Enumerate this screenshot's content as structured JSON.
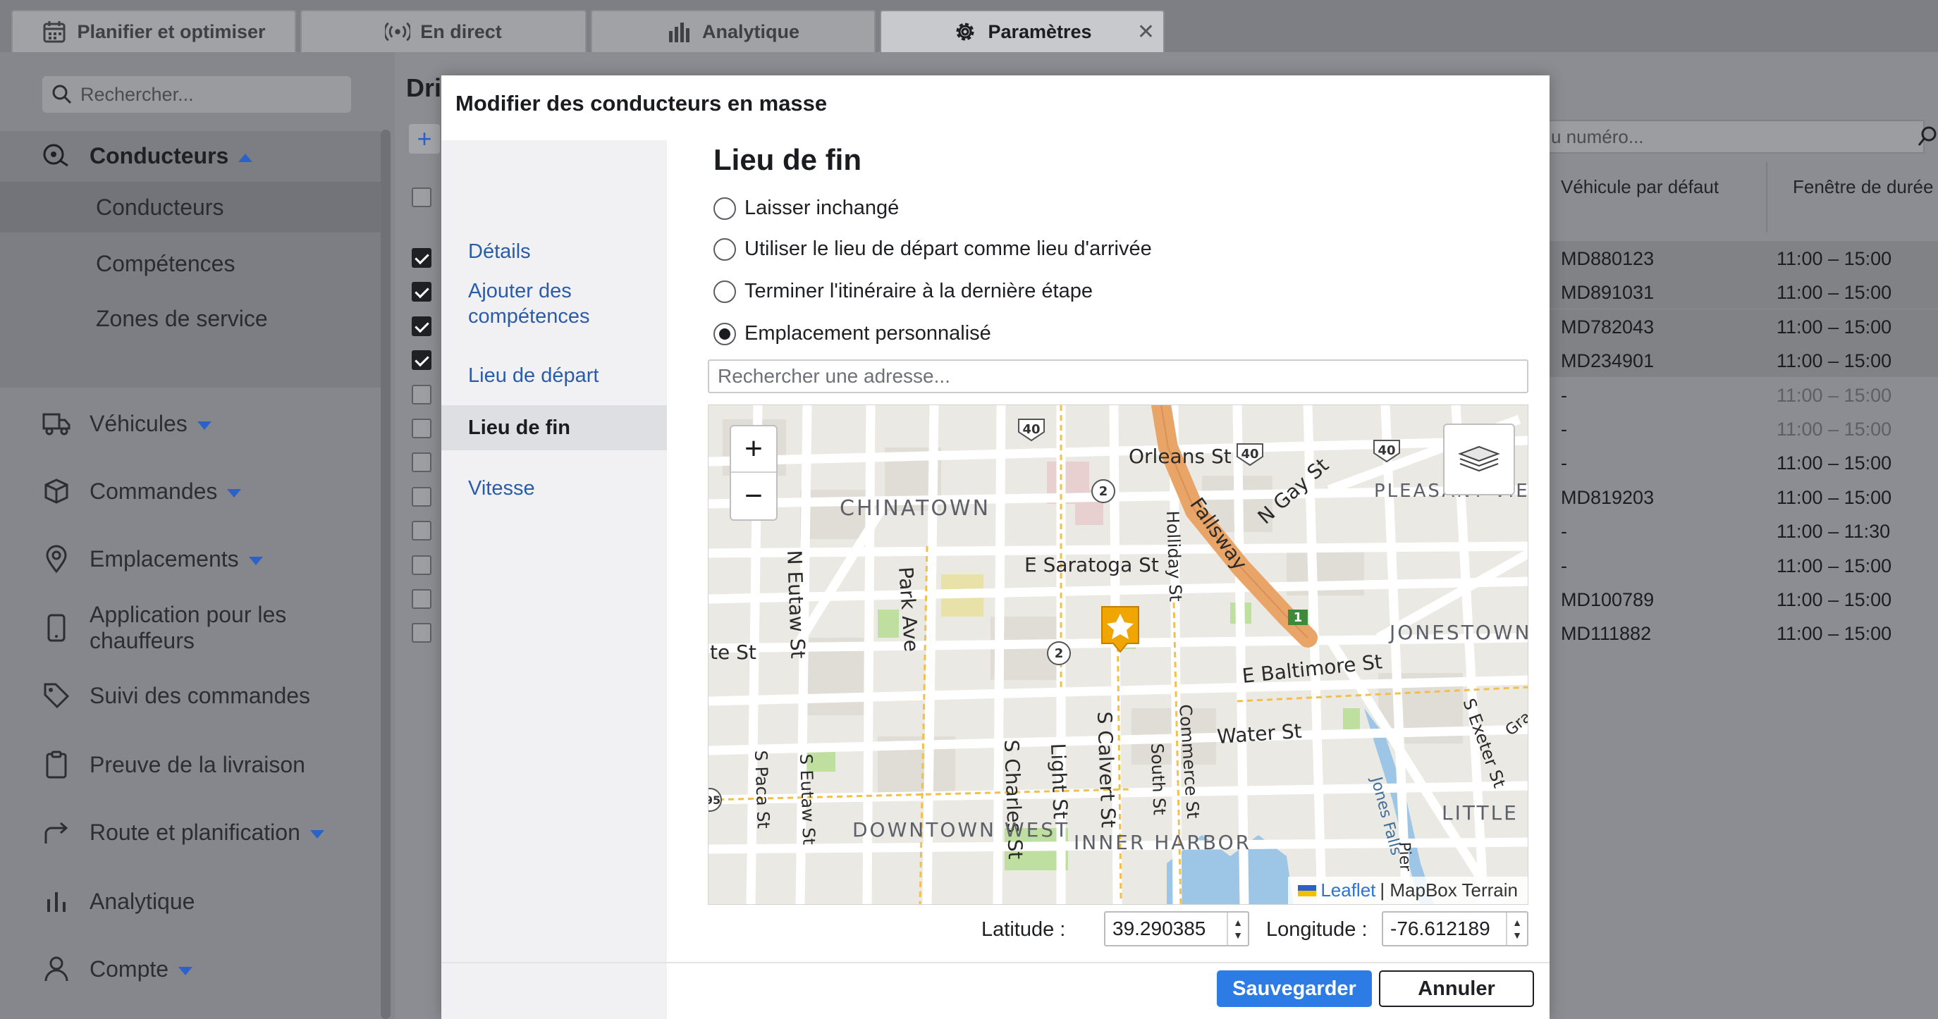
{
  "tabs": [
    {
      "label": "Planifier et optimiser",
      "icon": "calendar-icon"
    },
    {
      "label": "En direct",
      "icon": "broadcast-icon"
    },
    {
      "label": "Analytique",
      "icon": "bar-chart-icon"
    },
    {
      "label": "Paramètres",
      "icon": "gear-icon",
      "active": true,
      "close": "✕"
    }
  ],
  "sidebar": {
    "search_placeholder": "Rechercher...",
    "drivers": {
      "label": "Conducteurs"
    },
    "sub_items": [
      "Conducteurs",
      "Compétences",
      "Zones de service"
    ],
    "items": [
      {
        "label": "Véhicules",
        "icon": "truck-icon",
        "caret": true
      },
      {
        "label": "Commandes",
        "icon": "box-icon",
        "caret": true
      },
      {
        "label": "Emplacements",
        "icon": "location-pin-icon",
        "caret": true
      },
      {
        "label": "Application pour les chauffeurs",
        "icon": "phone-icon",
        "caret": false
      },
      {
        "label": "Suivi des commandes",
        "icon": "tag-icon",
        "caret": false
      },
      {
        "label": "Preuve de la livraison",
        "icon": "clipboard-icon",
        "caret": false
      },
      {
        "label": "Route et planification",
        "icon": "route-arrow-icon",
        "caret": true
      },
      {
        "label": "Analytique",
        "icon": "bar-chart-icon",
        "caret": false
      },
      {
        "label": "Compte",
        "icon": "user-icon",
        "caret": true
      }
    ]
  },
  "background": {
    "title_fragment": "Dri",
    "add_label": "+",
    "search_fragment": "u numéro...",
    "columns": [
      "Véhicule par défaut",
      "Fenêtre de durée"
    ],
    "rows": [
      {
        "checked": true,
        "vehicle": "MD880123",
        "window": "11:00 – 15:00"
      },
      {
        "checked": true,
        "vehicle": "MD891031",
        "window": "11:00 – 15:00"
      },
      {
        "checked": true,
        "vehicle": "MD782043",
        "window": "11:00 – 15:00"
      },
      {
        "checked": true,
        "vehicle": "MD234901",
        "window": "11:00 – 15:00"
      },
      {
        "checked": false,
        "vehicle": "-",
        "window": "11:00 – 15:00"
      },
      {
        "checked": false,
        "vehicle": "-",
        "window": "11:00 – 15:00"
      },
      {
        "checked": false,
        "vehicle": "-",
        "window": "11:00 – 15:00"
      },
      {
        "checked": false,
        "vehicle": "MD819203",
        "window": "11:00 – 15:00"
      },
      {
        "checked": false,
        "vehicle": "-",
        "window": "11:00 – 11:30"
      },
      {
        "checked": false,
        "vehicle": "-",
        "window": "11:00 – 15:00"
      },
      {
        "checked": false,
        "vehicle": "MD100789",
        "window": "11:00 – 15:00"
      },
      {
        "checked": false,
        "vehicle": "MD111882",
        "window": "11:00 – 15:00"
      }
    ]
  },
  "modal": {
    "title": "Modifier des conducteurs en masse",
    "nav": [
      "Détails",
      "Ajouter des compétences",
      "Lieu de départ",
      "Lieu de fin",
      "Vitesse"
    ],
    "selected_nav": "Lieu de fin",
    "section_title": "Lieu de fin",
    "options": [
      {
        "label": "Laisser inchangé",
        "selected": false
      },
      {
        "label": "Utiliser le lieu de départ comme lieu d'arrivée",
        "selected": false
      },
      {
        "label": "Terminer l'itinéraire à la dernière étape",
        "selected": false
      },
      {
        "label": "Emplacement personnalisé",
        "selected": true
      }
    ],
    "address_placeholder": "Rechercher une adresse...",
    "map": {
      "zoom_in": "+",
      "zoom_out": "−",
      "attribution_link": "Leaflet",
      "attribution_text": "| MapBox Terrain",
      "labels": [
        "CHINATOWN",
        "PLEASANT VIEW GARDENS",
        "JONESTOWN",
        "DOWNTOWN WEST",
        "INNER HARBOR",
        "LITTLE I",
        "Orleans St",
        "E Saratoga St",
        "E Baltimore St",
        "Water St",
        "Fallsway",
        "N Gay St",
        "Holliday St",
        "N Eutaw St",
        "Park Ave",
        "S Calvert St",
        "Commerce St",
        "South St",
        "Light St",
        "S Charles St",
        "S Eutaw St",
        "S Paca St",
        "S Exeter St",
        "Jones Falls",
        "Pier",
        "te St",
        "Gra",
        "40",
        "2",
        "1",
        "95"
      ]
    },
    "latitude_label": "Latitude :",
    "latitude": "39.290385",
    "longitude_label": "Longitude :",
    "longitude": "-76.612189",
    "save_label": "Sauvegarder",
    "cancel_label": "Annuler"
  }
}
